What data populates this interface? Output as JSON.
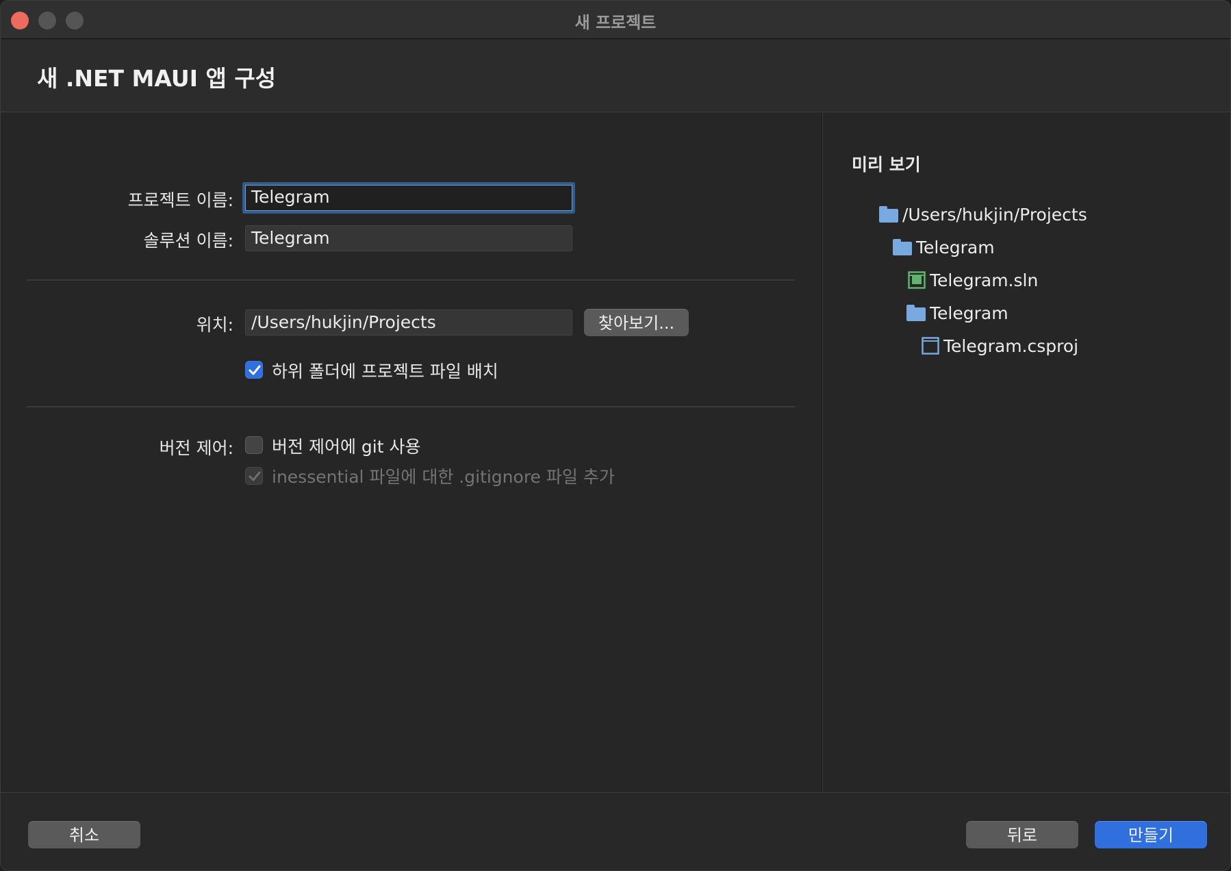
{
  "window": {
    "title": "새 프로젝트"
  },
  "header": {
    "title": "새 .NET MAUI 앱 구성"
  },
  "form": {
    "project_name_label": "프로젝트 이름:",
    "project_name_value": "Telegram",
    "solution_name_label": "솔루션 이름:",
    "solution_name_value": "Telegram",
    "location_label": "위치:",
    "location_value": "/Users/hukjin/Projects",
    "browse_label": "찾아보기...",
    "subfolder_label": "하위 폴더에 프로젝트 파일 배치",
    "subfolder_checked": true,
    "version_control_label": "버전 제어:",
    "use_git_label": "버전 제어에 git 사용",
    "use_git_checked": false,
    "gitignore_label": "inessential 파일에 대한 .gitignore 파일 추가",
    "gitignore_checked": true,
    "gitignore_disabled": true
  },
  "preview": {
    "title": "미리 보기",
    "tree": [
      {
        "label": "/Users/hukjin/Projects",
        "icon": "folder-icon",
        "depth": 0
      },
      {
        "label": "Telegram",
        "icon": "folder-icon",
        "depth": 1
      },
      {
        "label": "Telegram.sln",
        "icon": "solution-file-icon",
        "depth": 2
      },
      {
        "label": "Telegram",
        "icon": "folder-icon",
        "depth": 2
      },
      {
        "label": "Telegram.csproj",
        "icon": "project-file-icon",
        "depth": 3
      }
    ]
  },
  "footer": {
    "cancel_label": "취소",
    "back_label": "뒤로",
    "create_label": "만들기"
  },
  "colors": {
    "accent": "#2f6fde",
    "folder": "#78a9e0",
    "solution_icon": "#5fb36a",
    "close": "#ed6a5e"
  }
}
